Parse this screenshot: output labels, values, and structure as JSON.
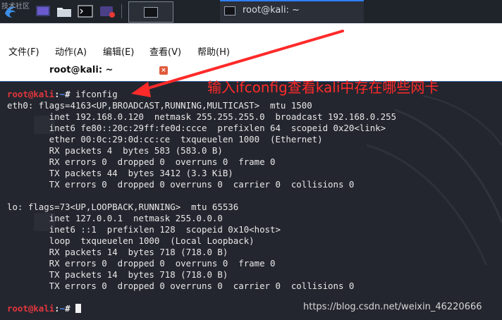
{
  "taskbar": {
    "corner_text": "技术社区",
    "icons": [
      "kali-dragon-icon",
      "desktop-icon",
      "folder-icon",
      "terminal-icon",
      "screen-recorder-icon"
    ],
    "window_title": "root@kali: ~"
  },
  "window": {
    "menu": [
      "文件(F)",
      "动作(A)",
      "编辑(E)",
      "查看(V)",
      "帮助(H)"
    ],
    "tab_title": "root@kali: ~",
    "tab_close": "×"
  },
  "terminal": {
    "prompt_user": "root@kali",
    "prompt_sep": ":",
    "prompt_path": "~",
    "prompt_hash": "# ",
    "command": "ifconfig",
    "output": [
      "eth0: flags=4163<UP,BROADCAST,RUNNING,MULTICAST>  mtu 1500",
      "        inet 192.168.0.120  netmask 255.255.255.0  broadcast 192.168.0.255",
      "        inet6 fe80::20c:29ff:fe0d:ccce  prefixlen 64  scopeid 0x20<link>",
      "        ether 00:0c:29:0d:cc:ce  txqueuelen 1000  (Ethernet)",
      "        RX packets 4  bytes 583 (583.0 B)",
      "        RX errors 0  dropped 0  overruns 0  frame 0",
      "        TX packets 44  bytes 3412 (3.3 KiB)",
      "        TX errors 0  dropped 0 overruns 0  carrier 0  collisions 0",
      "",
      "lo: flags=73<UP,LOOPBACK,RUNNING>  mtu 65536",
      "        inet 127.0.0.1  netmask 255.0.0.0",
      "        inet6 ::1  prefixlen 128  scopeid 0x10<host>",
      "        loop  txqueuelen 1000  (Local Loopback)",
      "        RX packets 14  bytes 718 (718.0 B)",
      "        RX errors 0  dropped 0  overruns 0  frame 0",
      "        TX packets 14  bytes 718 (718.0 B)",
      "        TX errors 0  dropped 0 overruns 0  carrier 0  collisions 0"
    ]
  },
  "annotation": {
    "text": "输入ifconfig查看kali中存在哪些网卡",
    "color": "#ff2a2a"
  },
  "watermark": "https://blog.csdn.net/weixin_46220666",
  "colors": {
    "prompt_user": "#e2363d",
    "prompt_path": "#4f8ef7",
    "terminal_bg": "#24262f",
    "accent": "#3465a4"
  }
}
